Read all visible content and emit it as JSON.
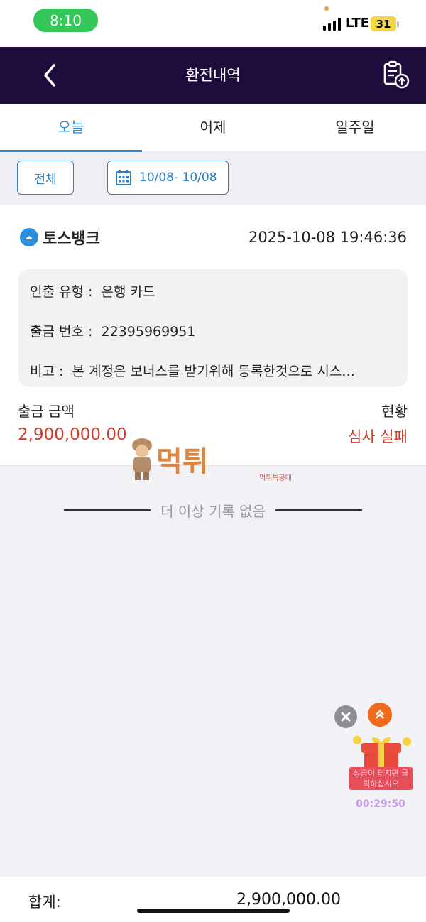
{
  "status_bar": {
    "time": "8:10",
    "network": "LTE",
    "battery": "31"
  },
  "header": {
    "title": "환전내역",
    "back_icon": "chevron-left-icon",
    "export_icon": "clipboard-upload-icon"
  },
  "tabs": [
    {
      "label": "오늘",
      "active": true
    },
    {
      "label": "어제",
      "active": false
    },
    {
      "label": "일주일",
      "active": false
    }
  ],
  "filters": {
    "all_label": "전체",
    "date_range": "10/08- 10/08"
  },
  "record": {
    "bank_name": "토스뱅크",
    "datetime": "2025-10-08 19:46:36",
    "details": [
      {
        "label": "인출 유형 :",
        "value": "은행 카드"
      },
      {
        "label": "출금 번호 :",
        "value": "22395969951"
      },
      {
        "label": "비고 :",
        "value": "본 계정은 보너스를 받기위해 등록한것으로 시스…"
      }
    ],
    "amount_label": "출금 금액",
    "amount_value": "2,900,000.00",
    "status_label": "현황",
    "status_value": "심사 실패"
  },
  "watermark": {
    "text": "먹튀",
    "sub": "먹튀특공대"
  },
  "no_more_text": "더 이상 기록 없음",
  "promo": {
    "banner_line1": "상금이 터지면 클",
    "banner_line2": "릭하십시오",
    "timer": "00:29:50"
  },
  "footer": {
    "total_label": "합계:",
    "total_value": "2,900,000.00"
  },
  "colors": {
    "header_bg": "#1e0d3c",
    "accent": "#2a8ad8",
    "danger": "#d23a2a"
  }
}
